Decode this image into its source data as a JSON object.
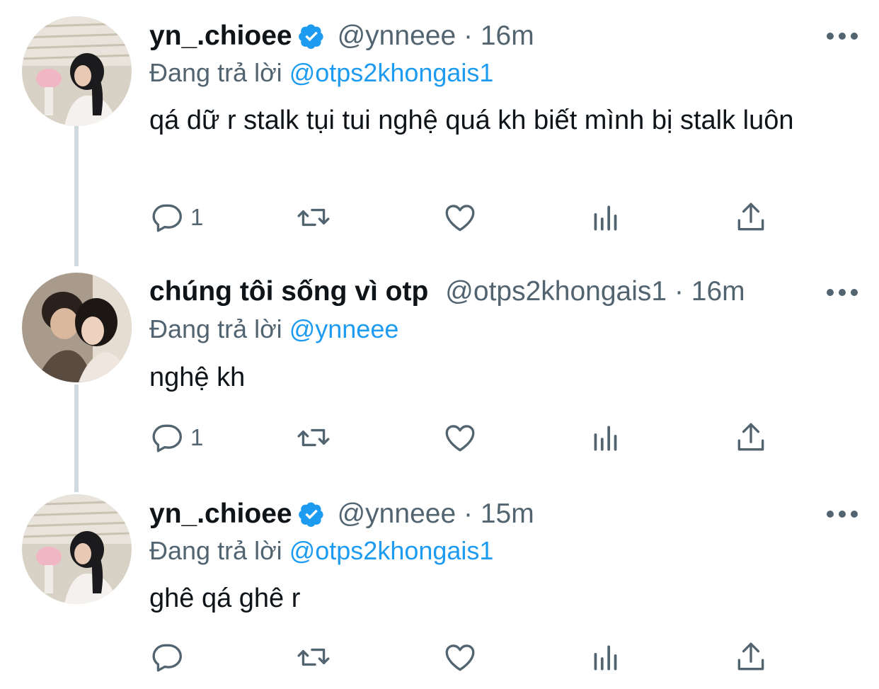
{
  "tweets": [
    {
      "name": "yn_.chioee",
      "verified": true,
      "handle": "@ynneee",
      "time": "16m",
      "replying_prefix": "Đang trả lời",
      "replying_to": "@otps2khongais1",
      "text": "qá dữ r stalk tụi tui nghệ quá kh biết mình bị stalk luôn",
      "reply_count": "1"
    },
    {
      "name": "chúng tôi sống vì otp",
      "verified": false,
      "handle": "@otps2khongais1",
      "time": "16m",
      "replying_prefix": "Đang trả lời",
      "replying_to": "@ynneee",
      "text": "nghệ kh",
      "reply_count": "1"
    },
    {
      "name": "yn_.chioee",
      "verified": true,
      "handle": "@ynneee",
      "time": "15m",
      "replying_prefix": "Đang trả lời",
      "replying_to": "@otps2khongais1",
      "text": "ghê qá ghê r",
      "reply_count": ""
    }
  ],
  "separator": "·",
  "icons": [
    "reply-icon",
    "retweet-icon",
    "like-icon",
    "analytics-icon",
    "share-icon",
    "more-icon",
    "verified-badge-icon"
  ],
  "colors": {
    "accent": "#1d9bf0",
    "secondary_text": "#536471",
    "thread_line": "#cfd9de"
  }
}
